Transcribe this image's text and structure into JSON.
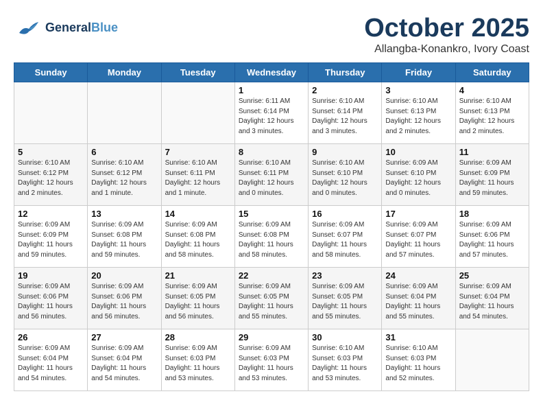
{
  "header": {
    "logo_general": "General",
    "logo_blue": "Blue",
    "month": "October 2025",
    "location": "Allangba-Konankro, Ivory Coast"
  },
  "weekdays": [
    "Sunday",
    "Monday",
    "Tuesday",
    "Wednesday",
    "Thursday",
    "Friday",
    "Saturday"
  ],
  "weeks": [
    [
      {
        "day": "",
        "info": ""
      },
      {
        "day": "",
        "info": ""
      },
      {
        "day": "",
        "info": ""
      },
      {
        "day": "1",
        "info": "Sunrise: 6:11 AM\nSunset: 6:14 PM\nDaylight: 12 hours\nand 3 minutes."
      },
      {
        "day": "2",
        "info": "Sunrise: 6:10 AM\nSunset: 6:14 PM\nDaylight: 12 hours\nand 3 minutes."
      },
      {
        "day": "3",
        "info": "Sunrise: 6:10 AM\nSunset: 6:13 PM\nDaylight: 12 hours\nand 2 minutes."
      },
      {
        "day": "4",
        "info": "Sunrise: 6:10 AM\nSunset: 6:13 PM\nDaylight: 12 hours\nand 2 minutes."
      }
    ],
    [
      {
        "day": "5",
        "info": "Sunrise: 6:10 AM\nSunset: 6:12 PM\nDaylight: 12 hours\nand 2 minutes."
      },
      {
        "day": "6",
        "info": "Sunrise: 6:10 AM\nSunset: 6:12 PM\nDaylight: 12 hours\nand 1 minute."
      },
      {
        "day": "7",
        "info": "Sunrise: 6:10 AM\nSunset: 6:11 PM\nDaylight: 12 hours\nand 1 minute."
      },
      {
        "day": "8",
        "info": "Sunrise: 6:10 AM\nSunset: 6:11 PM\nDaylight: 12 hours\nand 0 minutes."
      },
      {
        "day": "9",
        "info": "Sunrise: 6:10 AM\nSunset: 6:10 PM\nDaylight: 12 hours\nand 0 minutes."
      },
      {
        "day": "10",
        "info": "Sunrise: 6:09 AM\nSunset: 6:10 PM\nDaylight: 12 hours\nand 0 minutes."
      },
      {
        "day": "11",
        "info": "Sunrise: 6:09 AM\nSunset: 6:09 PM\nDaylight: 11 hours\nand 59 minutes."
      }
    ],
    [
      {
        "day": "12",
        "info": "Sunrise: 6:09 AM\nSunset: 6:09 PM\nDaylight: 11 hours\nand 59 minutes."
      },
      {
        "day": "13",
        "info": "Sunrise: 6:09 AM\nSunset: 6:08 PM\nDaylight: 11 hours\nand 59 minutes."
      },
      {
        "day": "14",
        "info": "Sunrise: 6:09 AM\nSunset: 6:08 PM\nDaylight: 11 hours\nand 58 minutes."
      },
      {
        "day": "15",
        "info": "Sunrise: 6:09 AM\nSunset: 6:08 PM\nDaylight: 11 hours\nand 58 minutes."
      },
      {
        "day": "16",
        "info": "Sunrise: 6:09 AM\nSunset: 6:07 PM\nDaylight: 11 hours\nand 58 minutes."
      },
      {
        "day": "17",
        "info": "Sunrise: 6:09 AM\nSunset: 6:07 PM\nDaylight: 11 hours\nand 57 minutes."
      },
      {
        "day": "18",
        "info": "Sunrise: 6:09 AM\nSunset: 6:06 PM\nDaylight: 11 hours\nand 57 minutes."
      }
    ],
    [
      {
        "day": "19",
        "info": "Sunrise: 6:09 AM\nSunset: 6:06 PM\nDaylight: 11 hours\nand 56 minutes."
      },
      {
        "day": "20",
        "info": "Sunrise: 6:09 AM\nSunset: 6:06 PM\nDaylight: 11 hours\nand 56 minutes."
      },
      {
        "day": "21",
        "info": "Sunrise: 6:09 AM\nSunset: 6:05 PM\nDaylight: 11 hours\nand 56 minutes."
      },
      {
        "day": "22",
        "info": "Sunrise: 6:09 AM\nSunset: 6:05 PM\nDaylight: 11 hours\nand 55 minutes."
      },
      {
        "day": "23",
        "info": "Sunrise: 6:09 AM\nSunset: 6:05 PM\nDaylight: 11 hours\nand 55 minutes."
      },
      {
        "day": "24",
        "info": "Sunrise: 6:09 AM\nSunset: 6:04 PM\nDaylight: 11 hours\nand 55 minutes."
      },
      {
        "day": "25",
        "info": "Sunrise: 6:09 AM\nSunset: 6:04 PM\nDaylight: 11 hours\nand 54 minutes."
      }
    ],
    [
      {
        "day": "26",
        "info": "Sunrise: 6:09 AM\nSunset: 6:04 PM\nDaylight: 11 hours\nand 54 minutes."
      },
      {
        "day": "27",
        "info": "Sunrise: 6:09 AM\nSunset: 6:04 PM\nDaylight: 11 hours\nand 54 minutes."
      },
      {
        "day": "28",
        "info": "Sunrise: 6:09 AM\nSunset: 6:03 PM\nDaylight: 11 hours\nand 53 minutes."
      },
      {
        "day": "29",
        "info": "Sunrise: 6:09 AM\nSunset: 6:03 PM\nDaylight: 11 hours\nand 53 minutes."
      },
      {
        "day": "30",
        "info": "Sunrise: 6:10 AM\nSunset: 6:03 PM\nDaylight: 11 hours\nand 53 minutes."
      },
      {
        "day": "31",
        "info": "Sunrise: 6:10 AM\nSunset: 6:03 PM\nDaylight: 11 hours\nand 52 minutes."
      },
      {
        "day": "",
        "info": ""
      }
    ]
  ]
}
